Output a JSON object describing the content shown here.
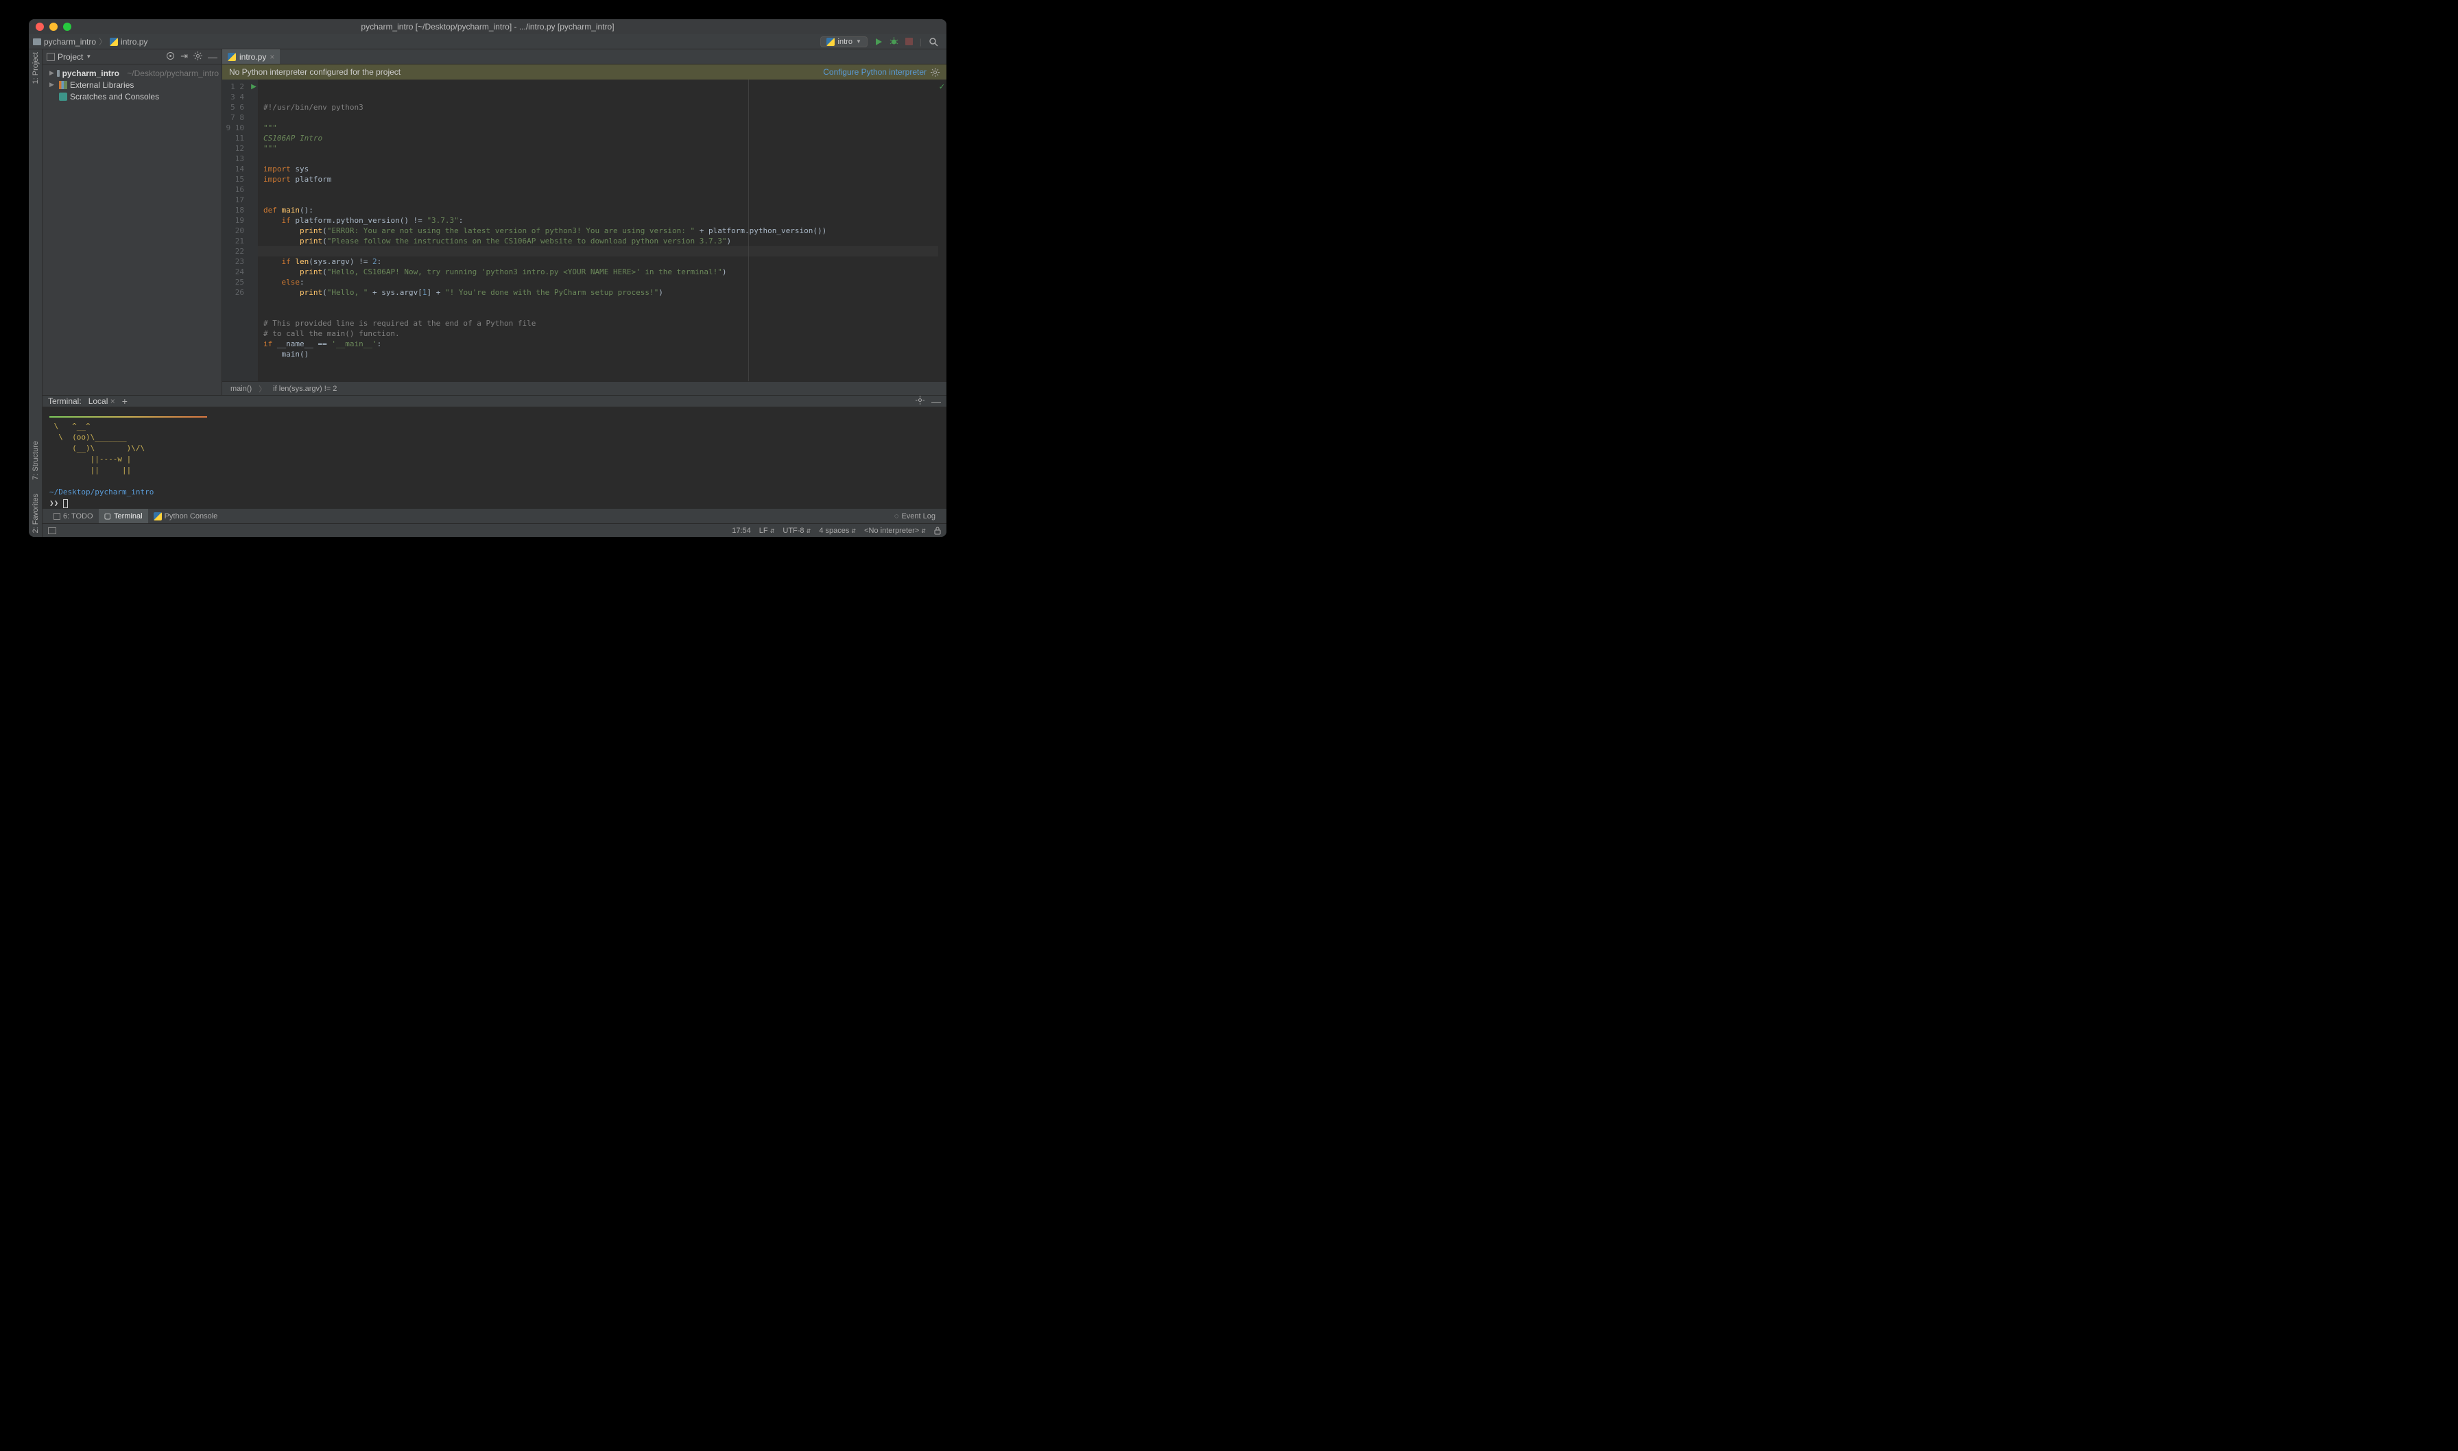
{
  "window_title": "pycharm_intro [~/Desktop/pycharm_intro] - .../intro.py [pycharm_intro]",
  "breadcrumb": {
    "project": "pycharm_intro",
    "file": "intro.py"
  },
  "run_config": {
    "label": "intro"
  },
  "sidebar": {
    "title": "Project",
    "items": [
      {
        "name": "pycharm_intro",
        "path": "~/Desktop/pycharm_intro"
      },
      {
        "name": "External Libraries"
      },
      {
        "name": "Scratches and Consoles"
      }
    ]
  },
  "tab": {
    "label": "intro.py"
  },
  "warning": {
    "text": "No Python interpreter configured for the project",
    "link": "Configure Python interpreter"
  },
  "code_lines": 26,
  "current_line": 17,
  "editor_breadcrumb": {
    "scope1": "main()",
    "scope2": "if len(sys.argv) != 2"
  },
  "terminal": {
    "title": "Terminal:",
    "tab": "Local",
    "cow": " \\   ^__^\n  \\  (oo)\\_______\n     (__)\\       )\\/\\\n         ||----w |\n         ||     ||",
    "cwd": "~/Desktop/pycharm_intro",
    "prompt": "❯❯"
  },
  "bottom_tabs": {
    "todo": "6: TODO",
    "terminal": "Terminal",
    "console": "Python Console",
    "eventlog": "Event Log"
  },
  "left_tabs": {
    "project": "1: Project",
    "structure": "7: Structure",
    "favorites": "2: Favorites"
  },
  "status": {
    "line_col": "17:54",
    "le": "LF",
    "enc": "UTF-8",
    "indent": "4 spaces",
    "interp": "<No interpreter>"
  }
}
